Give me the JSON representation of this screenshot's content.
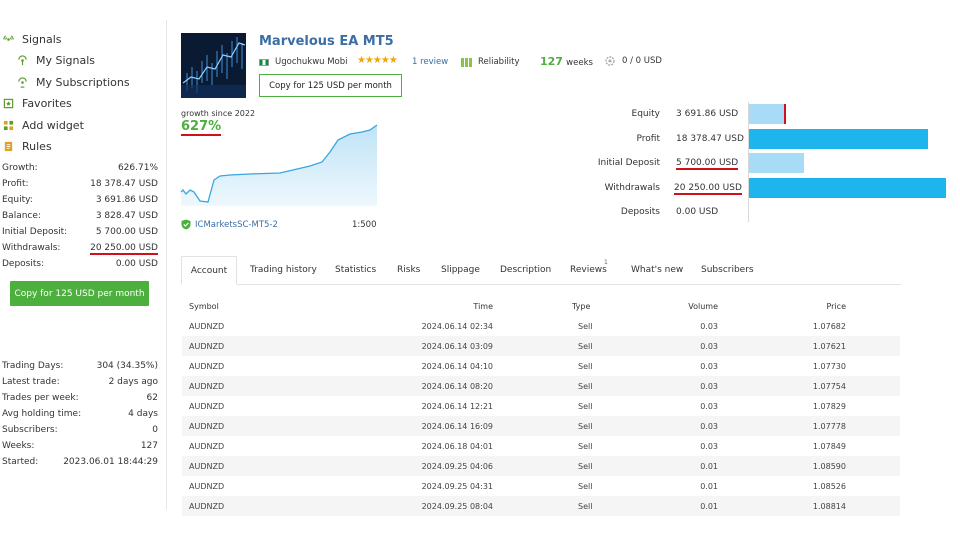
{
  "sidebar": {
    "nav": [
      {
        "label": "Signals",
        "icon": "signal-icon"
      },
      {
        "label": "My Signals",
        "icon": "my-signals-icon"
      },
      {
        "label": "My Subscriptions",
        "icon": "subscriptions-icon"
      },
      {
        "label": "Favorites",
        "icon": "favorites-icon"
      },
      {
        "label": "Add widget",
        "icon": "widget-icon"
      },
      {
        "label": "Rules",
        "icon": "rules-icon"
      }
    ],
    "stats": [
      {
        "label": "Growth:",
        "value": "626.71%"
      },
      {
        "label": "Profit:",
        "value": "18 378.47 USD"
      },
      {
        "label": "Equity:",
        "value": "3 691.86 USD"
      },
      {
        "label": "Balance:",
        "value": "3 828.47 USD"
      },
      {
        "label": "Initial Deposit:",
        "value": "5 700.00 USD"
      },
      {
        "label": "Withdrawals:",
        "value": "20 250.00 USD"
      },
      {
        "label": "Deposits:",
        "value": "0.00 USD"
      }
    ],
    "copy_button": "Copy for 125 USD per month",
    "stats2": [
      {
        "label": "Trading Days:",
        "value": "304 (34.35%)"
      },
      {
        "label": "Latest trade:",
        "value": "2 days ago"
      },
      {
        "label": "Trades per week:",
        "value": "62"
      },
      {
        "label": "Avg holding time:",
        "value": "4 days"
      },
      {
        "label": "Subscribers:",
        "value": "0"
      },
      {
        "label": "Weeks:",
        "value": "127"
      },
      {
        "label": "Started:",
        "value": "2023.06.01 18:44:29"
      }
    ]
  },
  "signal": {
    "title": "Marvelous EA MT5",
    "author": "Ugochukwu Mobi",
    "stars": "★★★★★",
    "reviews": "1 review",
    "reliability": "Reliability",
    "weeks_value": "127",
    "weeks_unit": "weeks",
    "subscribers_value": "0 / 0 USD",
    "copy_button": "Copy for 125 USD per month"
  },
  "growth": {
    "label": "growth since 2022",
    "value": "627%",
    "server": "ICMarketsSC-MT5-2",
    "leverage": "1:500"
  },
  "bars": [
    {
      "label": "Equity",
      "value": "3 691.86 USD",
      "fraction": 0.19,
      "color": "#a8dcf6",
      "underline": false
    },
    {
      "label": "Profit",
      "value": "18 378.47 USD",
      "fraction": 0.91,
      "color": "#1eb4ee",
      "underline": false
    },
    {
      "label": "Initial Deposit",
      "value": "5 700.00 USD",
      "fraction": 0.28,
      "color": "#a8dcf6",
      "underline": true
    },
    {
      "label": "Withdrawals",
      "value": "20 250.00 USD",
      "fraction": 1.0,
      "color": "#1eb4ee",
      "underline": true
    },
    {
      "label": "Deposits",
      "value": "0.00 USD",
      "fraction": 0,
      "color": "#a8dcf6",
      "underline": false
    }
  ],
  "tabs": [
    "Account",
    "Trading history",
    "Statistics",
    "Risks",
    "Slippage",
    "Description",
    "Reviews",
    "What's new",
    "Subscribers"
  ],
  "reviews_badge": "1",
  "table": {
    "headers": [
      "Symbol",
      "Time",
      "Type",
      "Volume",
      "Price"
    ],
    "rows": [
      [
        "AUDNZD",
        "2024.06.14 02:34",
        "Sell",
        "0.03",
        "1.07682"
      ],
      [
        "AUDNZD",
        "2024.06.14 03:09",
        "Sell",
        "0.03",
        "1.07621"
      ],
      [
        "AUDNZD",
        "2024.06.14 04:10",
        "Sell",
        "0.03",
        "1.07730"
      ],
      [
        "AUDNZD",
        "2024.06.14 08:20",
        "Sell",
        "0.03",
        "1.07754"
      ],
      [
        "AUDNZD",
        "2024.06.14 12:21",
        "Sell",
        "0.03",
        "1.07829"
      ],
      [
        "AUDNZD",
        "2024.06.14 16:09",
        "Sell",
        "0.03",
        "1.07778"
      ],
      [
        "AUDNZD",
        "2024.06.18 04:01",
        "Sell",
        "0.03",
        "1.07849"
      ],
      [
        "AUDNZD",
        "2024.09.25 04:06",
        "Sell",
        "0.01",
        "1.08590"
      ],
      [
        "AUDNZD",
        "2024.09.25 04:31",
        "Sell",
        "0.01",
        "1.08526"
      ],
      [
        "AUDNZD",
        "2024.09.25 08:04",
        "Sell",
        "0.01",
        "1.08814"
      ]
    ]
  },
  "colors": {
    "accent_green": "#4caf3e",
    "link_blue": "#3a6ea5",
    "bar_dark": "#1eb4ee",
    "bar_light": "#a8dcf6",
    "underline_red": "#d0101a"
  }
}
